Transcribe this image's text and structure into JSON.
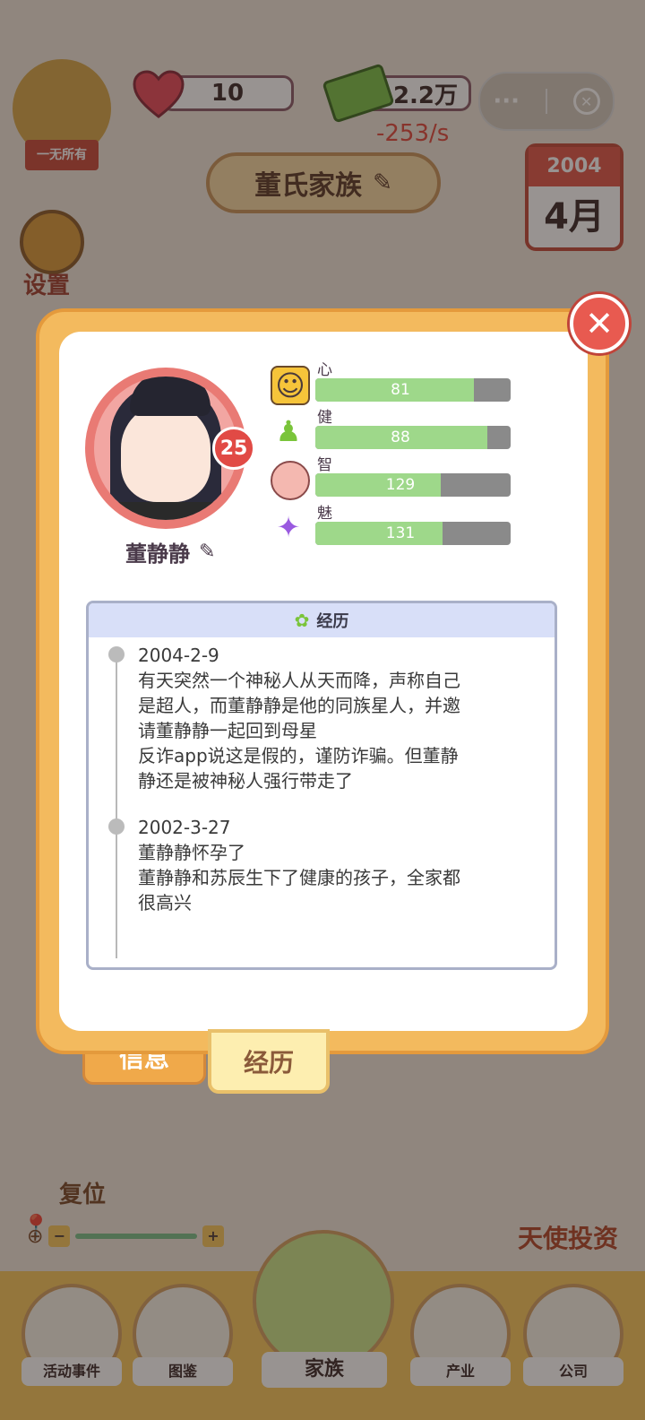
{
  "hud": {
    "hearts": "10",
    "money": "2.2万",
    "money_rate": "-253/s",
    "rank_label": "一无所有"
  },
  "header": {
    "family_name": "董氏家族"
  },
  "calendar": {
    "year": "2004",
    "month": "4月"
  },
  "side": {
    "settings": "设置",
    "relocate": "复位",
    "angel_invest": "天使投资"
  },
  "profile": {
    "name": "董静静",
    "age": "25",
    "stats": [
      {
        "label": "心情",
        "value": 81,
        "fill": 0.81
      },
      {
        "label": "健康",
        "value": 88,
        "fill": 0.88
      },
      {
        "label": "智商",
        "value": 129,
        "fill": 0.64
      },
      {
        "label": "魅力",
        "value": 131,
        "fill": 0.65
      }
    ]
  },
  "history": {
    "title": "经历",
    "entries": [
      {
        "date": "2004-2-9",
        "lines": [
          "有天突然一个神秘人从天而降，声称自己",
          "是超人，而董静静是他的同族星人，并邀",
          "请董静静一起回到母星",
          "反诈app说这是假的，谨防诈骗。但董静",
          "静还是被神秘人强行带走了"
        ]
      },
      {
        "date": "2002-3-27",
        "lines": [
          "董静静怀孕了",
          "董静静和苏辰生下了健康的孩子，全家都",
          "很高兴"
        ]
      }
    ]
  },
  "tabs": {
    "info": "信息",
    "history": "经历"
  },
  "bottom_nav": {
    "events": "活动事件",
    "codex": "图鉴",
    "family": "家族",
    "industry": "产业",
    "company": "公司"
  },
  "colors": {
    "accent": "#f3ba5e",
    "health_bar": "#9ed88a",
    "danger": "#e85a50"
  }
}
